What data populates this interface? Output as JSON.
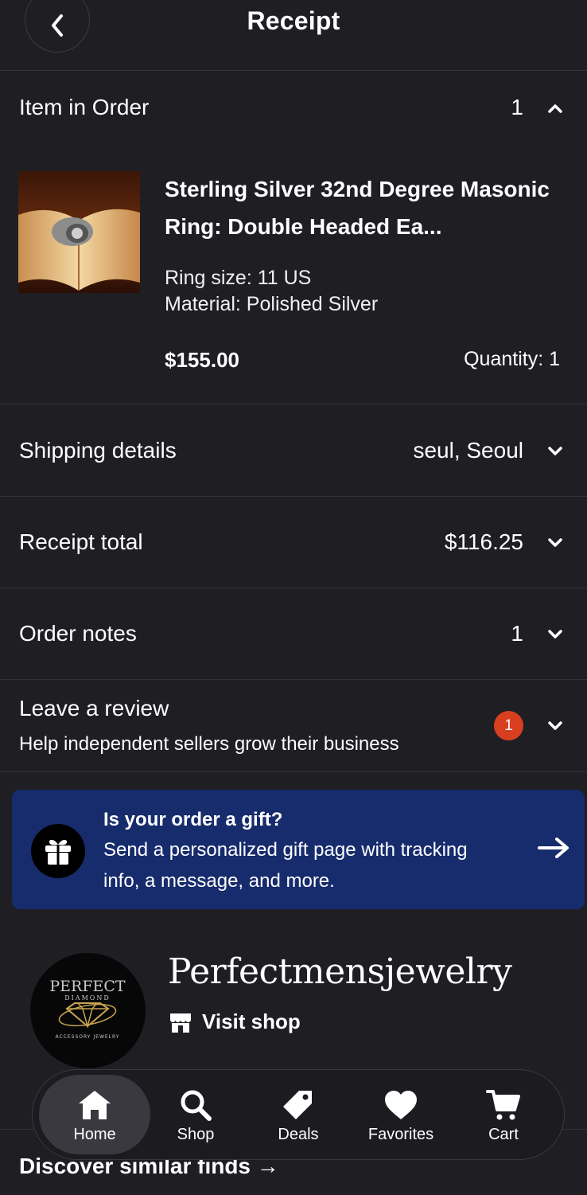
{
  "header": {
    "title": "Receipt"
  },
  "item_section": {
    "label": "Item in Order",
    "count": "1",
    "item": {
      "title": "Sterling Silver 32nd Degree Masonic Ring: Double Headed Ea...",
      "variations": [
        "Ring size: 11 US",
        "Material: Polished Silver"
      ],
      "price": "$155.00",
      "quantity": "Quantity: 1"
    }
  },
  "shipping": {
    "label": "Shipping details",
    "value": "seul, Seoul"
  },
  "receipt_total": {
    "label": "Receipt total",
    "value": "$116.25"
  },
  "order_notes": {
    "label": "Order notes",
    "value": "1"
  },
  "review": {
    "label": "Leave a review",
    "sub": "Help independent sellers grow their business",
    "badge": "1"
  },
  "gift_banner": {
    "title": "Is your order a gift?",
    "body": "Send a personalized gift page with tracking info, a message, and more."
  },
  "shop": {
    "name": "Perfectmensjewelry",
    "visit_label": "Visit shop",
    "logo_text": [
      "PERFECT",
      "DIAMOND",
      "ACCESSORY JEWELRY"
    ]
  },
  "discover": {
    "label": "Discover similar finds →"
  },
  "nav": [
    {
      "label": "Home",
      "icon": "home-icon"
    },
    {
      "label": "Shop",
      "icon": "search-icon"
    },
    {
      "label": "Deals",
      "icon": "tag-icon"
    },
    {
      "label": "Favorites",
      "icon": "heart-icon"
    },
    {
      "label": "Cart",
      "icon": "cart-icon"
    }
  ],
  "colors": {
    "background": "#1f1e23",
    "banner": "#172c6d",
    "badge": "#d83f1f",
    "divider": "#34333a"
  }
}
